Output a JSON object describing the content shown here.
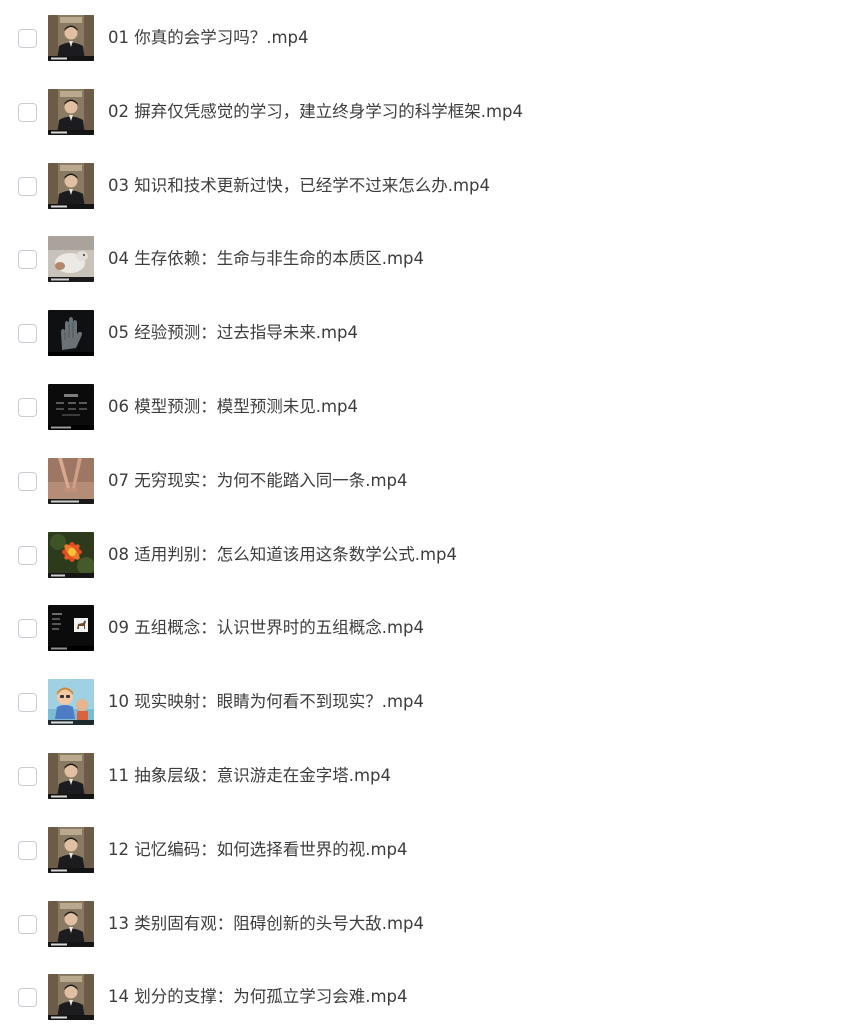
{
  "files": [
    {
      "name": "01 你真的会学习吗？.mp4",
      "thumbnail": "presenter-thumbnail",
      "checked": false
    },
    {
      "name": "02 摒弃仅凭感觉的学习，建立终身学习的科学框架.mp4",
      "thumbnail": "presenter-thumbnail",
      "checked": false
    },
    {
      "name": "03 知识和技术更新过快，已经学不过来怎么办.mp4",
      "thumbnail": "presenter-thumbnail",
      "checked": false
    },
    {
      "name": "04 生存依赖：生命与非生命的本质区.mp4",
      "thumbnail": "sheep-thumbnail",
      "checked": false
    },
    {
      "name": "05 经验预测：过去指导未来.mp4",
      "thumbnail": "hand-thumbnail",
      "checked": false
    },
    {
      "name": "06 模型预测：模型预测未见.mp4",
      "thumbnail": "dark-diagram-thumbnail",
      "checked": false
    },
    {
      "name": "07 无穷现实：为何不能踏入同一条.mp4",
      "thumbnail": "legs-thumbnail",
      "checked": false
    },
    {
      "name": "08 适用判别：怎么知道该用这条数学公式.mp4",
      "thumbnail": "flower-thumbnail",
      "checked": false
    },
    {
      "name": "09 五组概念：认识世界时的五组概念.mp4",
      "thumbnail": "horse-diagram-thumbnail",
      "checked": false
    },
    {
      "name": "10 现实映射：眼睛为何看不到现实？.mp4",
      "thumbnail": "cartoon-thumbnail",
      "checked": false
    },
    {
      "name": "11 抽象层级：意识游走在金字塔.mp4",
      "thumbnail": "presenter-thumbnail",
      "checked": false
    },
    {
      "name": "12 记忆编码：如何选择看世界的视.mp4",
      "thumbnail": "presenter-thumbnail",
      "checked": false
    },
    {
      "name": "13 类别固有观：阻碍创新的头号大敌.mp4",
      "thumbnail": "presenter-thumbnail",
      "checked": false
    },
    {
      "name": "14 划分的支撑：为何孤立学习会难.mp4",
      "thumbnail": "presenter-thumbnail",
      "checked": false
    }
  ],
  "colors": {
    "text": "#3d3d3d",
    "checkbox_border": "#c9cdd4",
    "background": "#ffffff"
  }
}
